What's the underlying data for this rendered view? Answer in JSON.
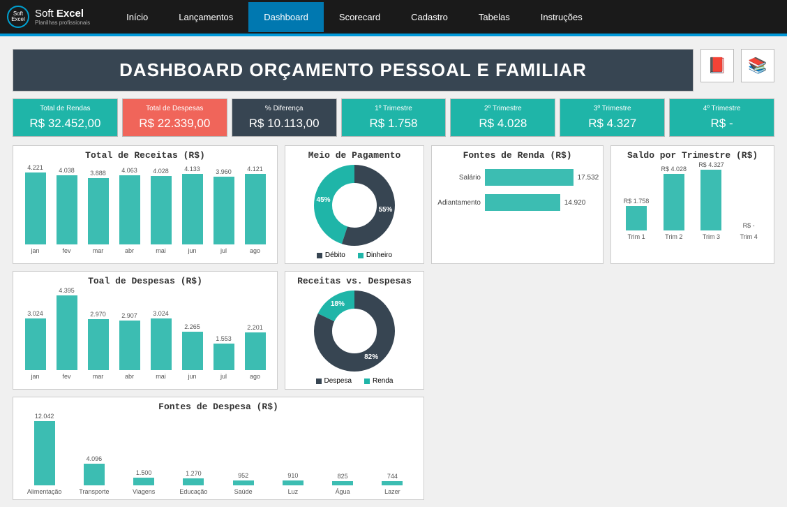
{
  "brand": {
    "name1": "Soft",
    "name2": "Excel",
    "sub": "Planilhas profissionais"
  },
  "nav": [
    "Início",
    "Lançamentos",
    "Dashboard",
    "Scorecard",
    "Cadastro",
    "Tabelas",
    "Instruções"
  ],
  "active_nav": 2,
  "title": "DASHBOARD ORÇAMENTO PESSOAL E FAMILIAR",
  "cards": [
    {
      "label": "Total de Rendas",
      "value": "R$ 32.452,00",
      "cls": "teal"
    },
    {
      "label": "Total de Despesas",
      "value": "R$ 22.339,00",
      "cls": "red"
    },
    {
      "label": "% Diferença",
      "value": "R$ 10.113,00",
      "cls": "dark"
    },
    {
      "label": "1º Trimestre",
      "value": "R$ 1.758",
      "cls": "teal"
    },
    {
      "label": "2º Trimestre",
      "value": "R$ 4.028",
      "cls": "teal"
    },
    {
      "label": "3º Trimestre",
      "value": "R$ 4.327",
      "cls": "teal"
    },
    {
      "label": "4º Trimestre",
      "value": "R$ -",
      "cls": "teal"
    }
  ],
  "colors": {
    "teal": "#3cbdb2",
    "dark": "#374552",
    "red": "#f0655a"
  },
  "chart_data": [
    {
      "id": "receitas",
      "type": "bar",
      "title": "Total de Receitas (R$)",
      "categories": [
        "jan",
        "fev",
        "mar",
        "abr",
        "mai",
        "jun",
        "jul",
        "ago"
      ],
      "values": [
        4221,
        4038,
        3888,
        4063,
        4028,
        4133,
        3960,
        4121
      ],
      "ylim": [
        0,
        4500
      ]
    },
    {
      "id": "despesas",
      "type": "bar",
      "title": "Toal de Despesas (R$)",
      "categories": [
        "jan",
        "fev",
        "mar",
        "abr",
        "mai",
        "jun",
        "jul",
        "ago"
      ],
      "values": [
        3024,
        4395,
        2970,
        2907,
        3024,
        2265,
        1553,
        2201
      ],
      "ylim": [
        0,
        4500
      ]
    },
    {
      "id": "pagamento",
      "type": "pie",
      "title": "Meio de Pagamento",
      "series": [
        {
          "name": "Débito",
          "value": 55,
          "color": "#374552"
        },
        {
          "name": "Dinheiro",
          "value": 45,
          "color": "#1fb5a8"
        }
      ]
    },
    {
      "id": "rec_vs_desp",
      "type": "pie",
      "title": "Receitas vs. Despesas",
      "series": [
        {
          "name": "Despesa",
          "value": 82,
          "color": "#374552"
        },
        {
          "name": "Renda",
          "value": 18,
          "color": "#1fb5a8"
        }
      ]
    },
    {
      "id": "fontes_renda",
      "type": "bar",
      "orientation": "horizontal",
      "title": "Fontes de Renda (R$)",
      "categories": [
        "Salário",
        "Adiantamento"
      ],
      "values": [
        17532,
        14920
      ],
      "xlim": [
        0,
        18000
      ]
    },
    {
      "id": "saldo_trim",
      "type": "bar",
      "title": "Saldo por Trimestre (R$)",
      "categories": [
        "Trim 1",
        "Trim 2",
        "Trim 3",
        "Trim 4"
      ],
      "labels": [
        "R$ 1.758",
        "R$ 4.028",
        "R$ 4.327",
        "R$ -"
      ],
      "values": [
        1758,
        4028,
        4327,
        0
      ],
      "ylim": [
        0,
        4500
      ]
    },
    {
      "id": "fontes_despesa",
      "type": "bar",
      "title": "Fontes de Despesa (R$)",
      "categories": [
        "Alimentação",
        "Transporte",
        "Viagens",
        "Educação",
        "Saúde",
        "Luz",
        "Água",
        "Lazer"
      ],
      "values": [
        12042,
        4096,
        1500,
        1270,
        952,
        910,
        825,
        744
      ],
      "ylim": [
        0,
        12500
      ]
    }
  ]
}
